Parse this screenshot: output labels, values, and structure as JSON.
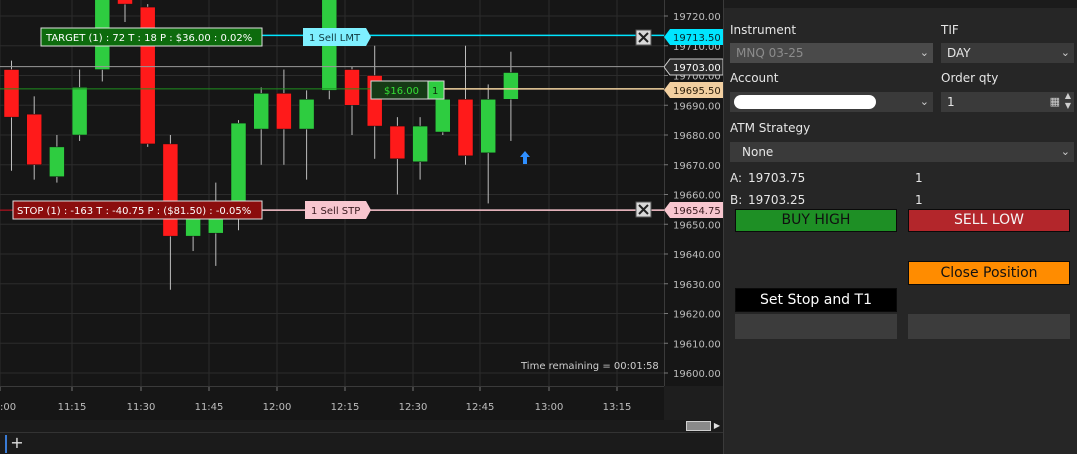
{
  "chart": {
    "price_ticks": [
      "19720.00",
      "19710.00",
      "19700.00",
      "19690.00",
      "19680.00",
      "19670.00",
      "19660.00",
      "19650.00",
      "19640.00",
      "19630.00",
      "19620.00",
      "19610.00",
      "19600.00"
    ],
    "time_ticks": [
      ":00",
      "11:15",
      "11:30",
      "11:45",
      "12:00",
      "12:15",
      "12:30",
      "12:45",
      "13:00",
      "13:15"
    ],
    "time_remaining": "Time remaining = 00:01:58",
    "target_label": "TARGET (1) : 72 T : 18 P : $36.00 : 0.02%",
    "stop_label": "STOP (1) : -163 T : -40.75 P : ($81.50) : -0.05%",
    "sell_lmt_label": "1  Sell LMT",
    "sell_stp_label": "1  Sell STP",
    "position_pnl": "$16.00",
    "position_qty": "1",
    "tag_sell_lmt_price": "19713.50",
    "tag_last_price": "19703.00",
    "tag_avg_price": "19695.50",
    "tag_stop_price": "19654.75",
    "colors": {
      "up": "#2ecc40",
      "down": "#ff1a1a",
      "target": "#00e5ff",
      "stop": "#f8c6cf",
      "avg": "#f2cfa0",
      "last": "#2b2b2b"
    },
    "candles": [
      {
        "o": 19702,
        "h": 19705,
        "l": 19668,
        "c": 19686
      },
      {
        "o": 19687,
        "h": 19693,
        "l": 19665,
        "c": 19670
      },
      {
        "o": 19666,
        "h": 19680,
        "l": 19664,
        "c": 19676
      },
      {
        "o": 19680,
        "h": 19702,
        "l": 19678,
        "c": 19696
      },
      {
        "o": 19702,
        "h": 19738,
        "l": 19698,
        "c": 19734
      },
      {
        "o": 19736,
        "h": 19740,
        "l": 19718,
        "c": 19724
      },
      {
        "o": 19723,
        "h": 19724,
        "l": 19676,
        "c": 19677
      },
      {
        "o": 19677,
        "h": 19680,
        "l": 19628,
        "c": 19646
      },
      {
        "o": 19646,
        "h": 19654,
        "l": 19641,
        "c": 19654
      },
      {
        "o": 19647,
        "h": 19664,
        "l": 19636,
        "c": 19657
      },
      {
        "o": 19655,
        "h": 19685,
        "l": 19648,
        "c": 19684
      },
      {
        "o": 19682,
        "h": 19696,
        "l": 19670,
        "c": 19694
      },
      {
        "o": 19694,
        "h": 19702,
        "l": 19670,
        "c": 19682
      },
      {
        "o": 19682,
        "h": 19695,
        "l": 19665,
        "c": 19692
      },
      {
        "o": 19695,
        "h": 19735,
        "l": 19692,
        "c": 19734
      },
      {
        "o": 19702,
        "h": 19703,
        "l": 19680,
        "c": 19690
      },
      {
        "o": 19700,
        "h": 19710,
        "l": 19672,
        "c": 19683
      },
      {
        "o": 19683,
        "h": 19686,
        "l": 19660,
        "c": 19672
      },
      {
        "o": 19671,
        "h": 19686,
        "l": 19665,
        "c": 19683
      },
      {
        "o": 19681,
        "h": 19697,
        "l": 19680,
        "c": 19692
      },
      {
        "o": 19692,
        "h": 19710,
        "l": 19670,
        "c": 19673
      },
      {
        "o": 19674,
        "h": 19697,
        "l": 19657,
        "c": 19692
      },
      {
        "o": 19692,
        "h": 19708,
        "l": 19678,
        "c": 19701
      }
    ]
  },
  "order_entry": {
    "instrument_label": "Instrument",
    "instrument_value": "MNQ 03-25",
    "tif_label": "TIF",
    "tif_value": "DAY",
    "account_label": "Account",
    "account_value": "",
    "order_qty_label": "Order qty",
    "order_qty_value": "1",
    "atm_label": "ATM Strategy",
    "atm_value": "None",
    "ask_label": "A:",
    "ask_price": "19703.75",
    "ask_size": "1",
    "bid_label": "B:",
    "bid_price": "19703.25",
    "bid_size": "1",
    "buy_label": "BUY HIGH",
    "sell_label": "SELL LOW",
    "close_label": "Close Position",
    "stop_t1_label": "Set Stop and T1"
  }
}
